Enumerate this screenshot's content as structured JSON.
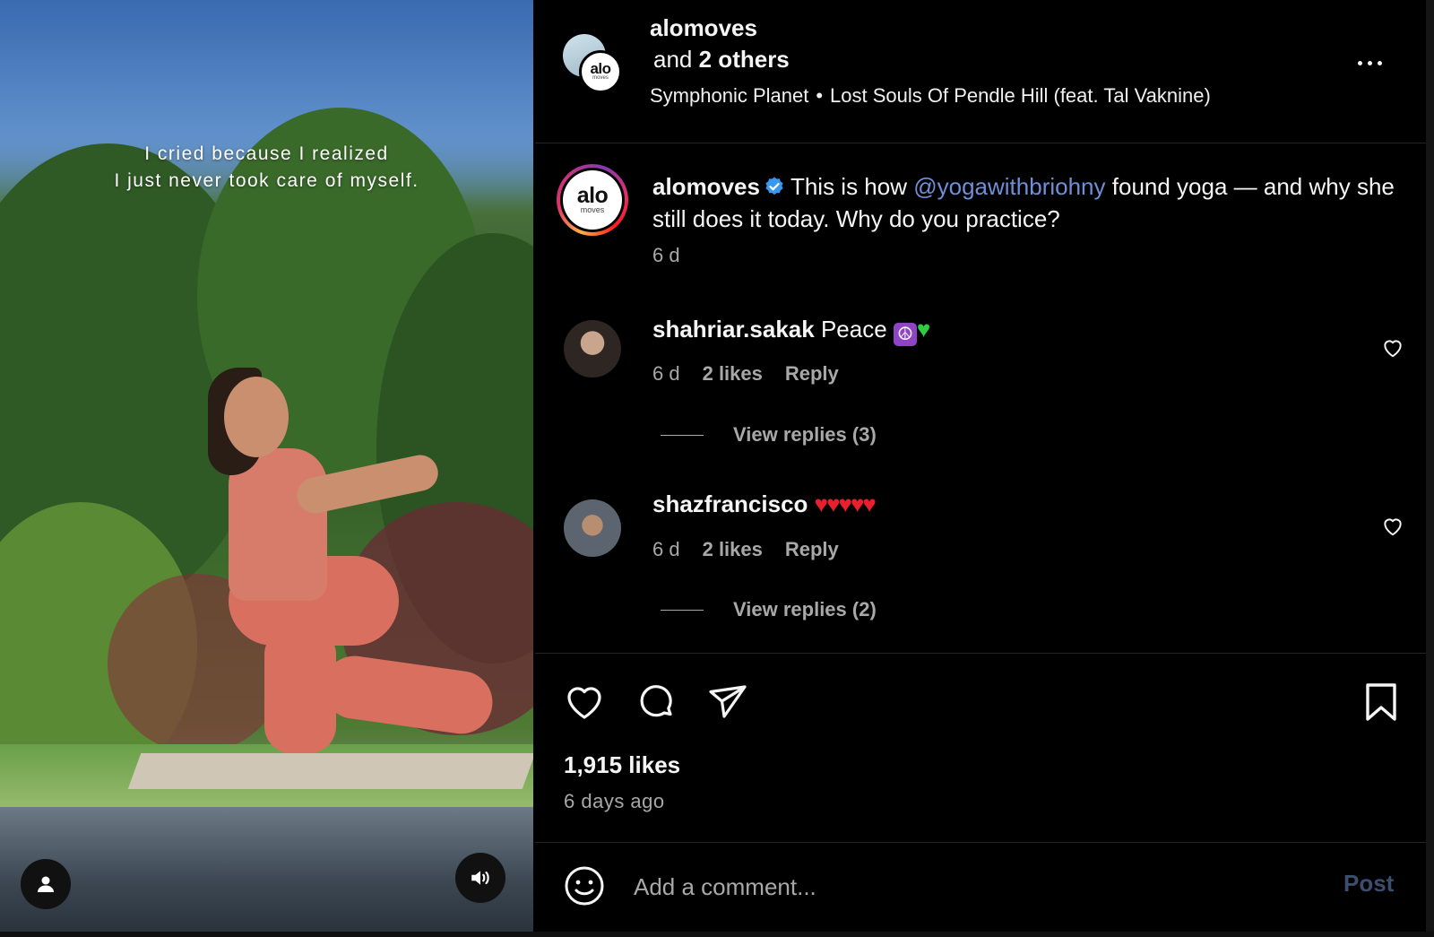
{
  "media": {
    "overlay_text_line1": "I cried because I realized",
    "overlay_text_line2": "I just never took care of myself.",
    "icons": {
      "profile": "user-icon",
      "sound": "speaker-icon"
    }
  },
  "header": {
    "username": "alomoves",
    "others_prefix": "and",
    "others_count": "2 others",
    "audio_artist": "Symphonic Planet",
    "audio_separator": "•",
    "audio_title": "Lost Souls Of Pendle Hill (feat. Tal Vaknine)",
    "avatar_mark": "alo",
    "avatar_sub": "moves"
  },
  "caption": {
    "username": "alomoves",
    "text_before": "This is how",
    "mention": "@yogawithbriohny",
    "text_after": "found yoga — and why she still does it today. Why do you practice?",
    "time": "6 d",
    "avatar_mark": "alo",
    "avatar_sub": "moves",
    "mention_color": "#6f8fd8",
    "verified_color": "#3897f0"
  },
  "comments": [
    {
      "username": "shahriar.sakak",
      "text": "Peace",
      "emoji_1": "☮",
      "emoji_2": "♥",
      "time": "6 d",
      "likes": "2 likes",
      "reply": "Reply",
      "view_replies": "View replies (3)"
    },
    {
      "username": "shazfrancisco",
      "text": "",
      "emoji_1": "♥♥♥♥♥",
      "time": "6 d",
      "likes": "2 likes",
      "reply": "Reply",
      "view_replies": "View replies (2)"
    }
  ],
  "stats": {
    "likes": "1,915 likes",
    "age": "6 days ago"
  },
  "composer": {
    "placeholder": "Add a comment...",
    "post_label": "Post",
    "post_color": "#3c4e6e"
  }
}
